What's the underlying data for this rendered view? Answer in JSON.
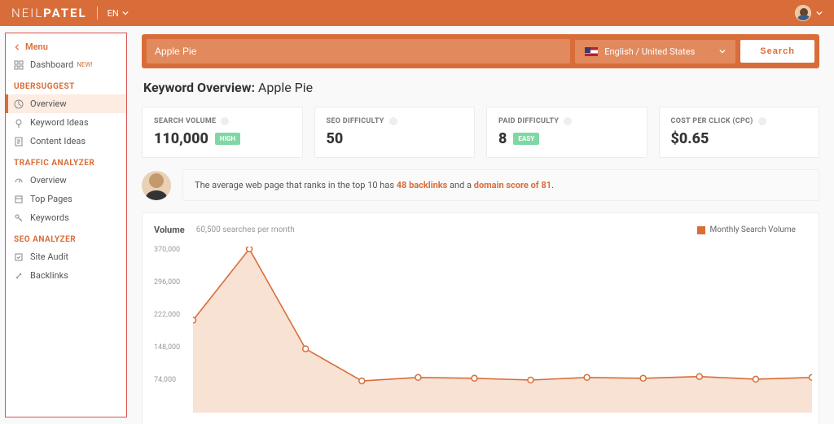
{
  "header": {
    "brand_thin": "NEIL",
    "brand_bold": "PATEL",
    "lang": "EN"
  },
  "sidebar": {
    "menu_label": "Menu",
    "dashboard": "Dashboard",
    "new_badge": "NEW!",
    "ubersuggest": {
      "title": "UBERSUGGEST",
      "overview": "Overview",
      "keyword_ideas": "Keyword Ideas",
      "content_ideas": "Content Ideas"
    },
    "traffic": {
      "title": "TRAFFIC ANALYZER",
      "overview": "Overview",
      "top_pages": "Top Pages",
      "keywords": "Keywords"
    },
    "seo": {
      "title": "SEO ANALYZER",
      "site_audit": "Site Audit",
      "backlinks": "Backlinks"
    }
  },
  "search": {
    "value": "Apple Pie",
    "locale": "English / United States",
    "button": "Search"
  },
  "title": {
    "prefix": "Keyword Overview:",
    "keyword": "Apple Pie"
  },
  "cards": {
    "search_volume": {
      "label": "SEARCH VOLUME",
      "value": "110,000",
      "pill": "HIGH",
      "pill_color": "#7fd8a4"
    },
    "seo_difficulty": {
      "label": "SEO DIFFICULTY",
      "value": "50"
    },
    "paid_difficulty": {
      "label": "PAID DIFFICULTY",
      "value": "8",
      "pill": "EASY",
      "pill_color": "#7fd8a4"
    },
    "cpc": {
      "label": "COST PER CLICK (CPC)",
      "value": "$0.65"
    }
  },
  "insight": {
    "pre": "The average web page that ranks in the top 10 has ",
    "backlinks": "48 backlinks",
    "mid": " and a ",
    "domain_score": "domain score of 81",
    "post": "."
  },
  "chart": {
    "title": "Volume",
    "subtitle": "60,500 searches per month",
    "legend": "Monthly Search Volume"
  },
  "chart_data": {
    "type": "area",
    "title": "Volume",
    "ylabel": "",
    "xlabel": "",
    "ylim": [
      0,
      370000
    ],
    "y_ticks": [
      74000,
      148000,
      222000,
      296000,
      370000
    ],
    "series": [
      {
        "name": "Monthly Search Volume",
        "values": [
          210000,
          372000,
          145000,
          72000,
          80000,
          78000,
          74000,
          80000,
          78000,
          82000,
          76000,
          80000
        ]
      }
    ]
  }
}
